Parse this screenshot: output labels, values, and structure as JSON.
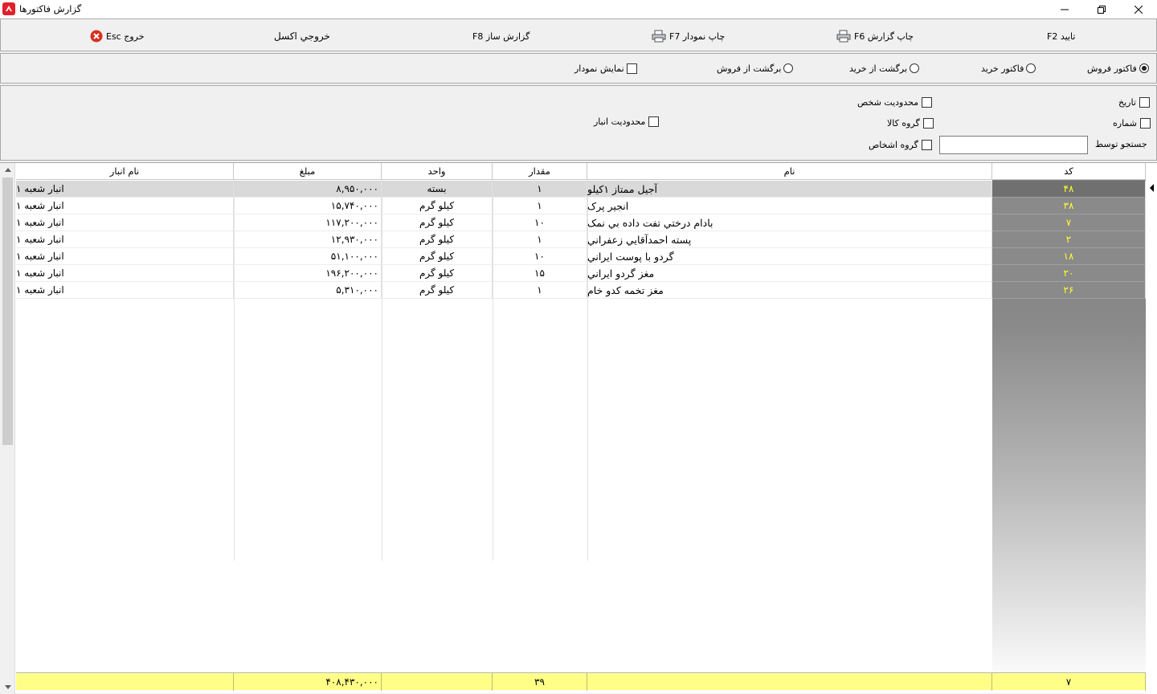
{
  "window": {
    "title": "گزارش فاکتورها",
    "icon": "app-logo-icon"
  },
  "toolbar": {
    "confirm": "تایید F2",
    "print_report": "چاپ گزارش F6",
    "print_chart": "چاپ نمودار F7",
    "report_builder": "گزارش ساز F8",
    "excel_export": "خروجي اکسل",
    "exit": "خروج Esc"
  },
  "options": {
    "invoice_type": [
      {
        "label": "فاکتور فروش",
        "selected": true
      },
      {
        "label": "فاکتور خريد",
        "selected": false
      },
      {
        "label": "برگشت از خريد",
        "selected": false
      },
      {
        "label": "برگشت از فروش",
        "selected": false
      }
    ],
    "show_chart": {
      "label": "نمايش نمودار",
      "checked": false
    }
  },
  "filters": {
    "date": "تاريخ",
    "number": "شماره",
    "search_by": "جستجو توسط",
    "search_value": "",
    "person_limit": "محدوديت شخص",
    "goods_group": "گروه کالا",
    "persons_group": "گروه اشخاص",
    "warehouse_limit": "محدوديت انبار"
  },
  "grid": {
    "columns": {
      "code": "کد",
      "name": "نام",
      "qty": "مقدار",
      "unit": "واحد",
      "amount": "مبلغ",
      "warehouse": "نام انبار"
    },
    "rows": [
      {
        "code": "۴۸",
        "name": "آجيل ممتاز ۱کيلو",
        "qty": "۱",
        "unit": "بسته",
        "amount": "۸,۹۵۰,۰۰۰",
        "warehouse": "انبار شعبه ۱"
      },
      {
        "code": "۳۸",
        "name": "انجير پرک",
        "qty": "۱",
        "unit": "کيلو گرم",
        "amount": "۱۵,۷۴۰,۰۰۰",
        "warehouse": "انبار شعبه ۱"
      },
      {
        "code": "۷",
        "name": "بادام درختي تفت داده بي نمک",
        "qty": "۱۰",
        "unit": "کيلو گرم",
        "amount": "۱۱۷,۲۰۰,۰۰۰",
        "warehouse": "انبار شعبه ۱"
      },
      {
        "code": "۲",
        "name": "پسته احمدآقايي زعفراني",
        "qty": "۱",
        "unit": "کيلو گرم",
        "amount": "۱۲,۹۳۰,۰۰۰",
        "warehouse": "انبار شعبه ۱"
      },
      {
        "code": "۱۸",
        "name": "گردو با پوست ايراني",
        "qty": "۱۰",
        "unit": "کيلو گرم",
        "amount": "۵۱,۱۰۰,۰۰۰",
        "warehouse": "انبار شعبه ۱"
      },
      {
        "code": "۲۰",
        "name": "مغز گردو ايراني",
        "qty": "۱۵",
        "unit": "کيلو گرم",
        "amount": "۱۹۶,۲۰۰,۰۰۰",
        "warehouse": "انبار شعبه ۱"
      },
      {
        "code": "۲۶",
        "name": "مغز تخمه کدو خام",
        "qty": "۱",
        "unit": "کيلو گرم",
        "amount": "۵,۳۱۰,۰۰۰",
        "warehouse": "انبار شعبه ۱"
      }
    ],
    "totals": {
      "count": "۷",
      "qty": "۳۹",
      "amount": "۴۰۸,۴۳۰,۰۰۰"
    }
  },
  "colors": {
    "code_text": "#ffff33",
    "footer_bg": "#ffff88",
    "exit_icon": "#d9301c"
  }
}
